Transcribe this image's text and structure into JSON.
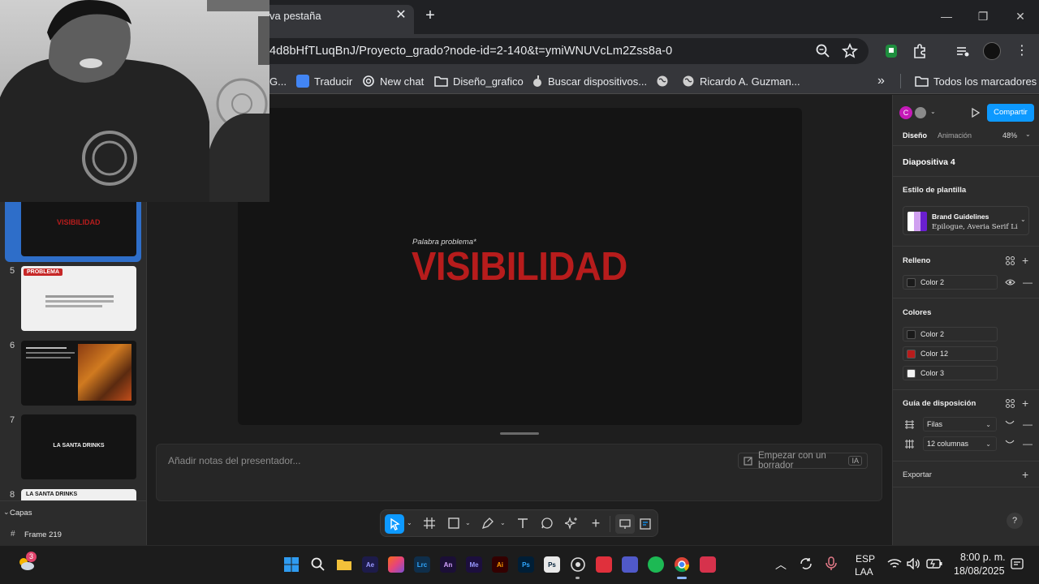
{
  "browser": {
    "tab_title": "va pestaña",
    "url": "4d8bHfTLuqBnJ/Proyecto_grado?node-id=2-140&t=ymiWNUVcLm2Zss8a-0",
    "bookmarks": [
      {
        "label": "G...",
        "icon": "bookmark-icon"
      },
      {
        "label": "Traducir",
        "icon": "translate-icon"
      },
      {
        "label": "New chat",
        "icon": "openai-icon"
      },
      {
        "label": "Diseño_grafico",
        "icon": "folder-icon"
      },
      {
        "label": "Buscar dispositivos...",
        "icon": "apple-icon"
      },
      {
        "label": "",
        "icon": "globe-icon"
      },
      {
        "label": "Ricardo A. Guzman...",
        "icon": "globe-icon"
      }
    ],
    "all_bookmarks": "Todos los marcadores",
    "more_glyph": "»"
  },
  "left_panel": {
    "slides": [
      {
        "num": "",
        "title": "VISIBILIDAD",
        "selected": true
      },
      {
        "num": "5",
        "title": "PROBLEMA"
      },
      {
        "num": "6",
        "title": ""
      },
      {
        "num": "7",
        "title": "LA SANTA DRINKS"
      },
      {
        "num": "8",
        "title": "LA SANTA DRINKS"
      }
    ],
    "layers_label": "Capas",
    "frame_label": "Frame 219"
  },
  "canvas": {
    "slide_subtitle": "Palabra problema*",
    "slide_title": "VISIBILIDAD",
    "notes_placeholder": "Añadir notas del presentador...",
    "draft_button": "Empezar con un borrador",
    "draft_badge": "IA"
  },
  "right_panel": {
    "avatar_letter": "C",
    "share_button": "Compartir",
    "tabs": [
      "Diseño",
      "Animación"
    ],
    "zoom": "48%",
    "slide_name": "Diapositiva 4",
    "template_style_label": "Estilo de plantilla",
    "template_name": "Brand Guidelines",
    "template_fonts": "Epilogue, Averia Serif Libr",
    "fill_label": "Relleno",
    "fill_color": "Color 2",
    "colors_label": "Colores",
    "colors": [
      {
        "name": "Color 2",
        "hex": "#1a1a1a"
      },
      {
        "name": "Color 12",
        "hex": "#b71c1c"
      },
      {
        "name": "Color 3",
        "hex": "#f2f2f2"
      }
    ],
    "layout_guide_label": "Guía de disposición",
    "rows_label": "Filas",
    "columns_label": "12 columnas",
    "export_label": "Exportar",
    "help": "?"
  },
  "taskbar": {
    "weather_badge": "3",
    "lang_1": "ESP",
    "lang_2": "LAA",
    "time": "8:00 p. m.",
    "date": "18/08/2025",
    "apps": [
      {
        "label": "Ae",
        "color": "#1d1b4a",
        "fg": "#9999ff"
      },
      {
        "label": "",
        "color": "#e6447a",
        "fg": "#fff"
      },
      {
        "label": "Lrc",
        "color": "#0f2e4a",
        "fg": "#31a8ff"
      },
      {
        "label": "An",
        "color": "#1b0f36",
        "fg": "#d3a3ff"
      },
      {
        "label": "Me",
        "color": "#1c0f3d",
        "fg": "#9999ff"
      },
      {
        "label": "Ai",
        "color": "#330000",
        "fg": "#ff9a00"
      },
      {
        "label": "Ps",
        "color": "#001e36",
        "fg": "#31a8ff"
      },
      {
        "label": "Ps",
        "color": "#e9e9e9",
        "fg": "#001e36"
      }
    ]
  },
  "colors": {
    "accent_blue": "#0d99ff",
    "brand_red": "#b71c1c"
  }
}
